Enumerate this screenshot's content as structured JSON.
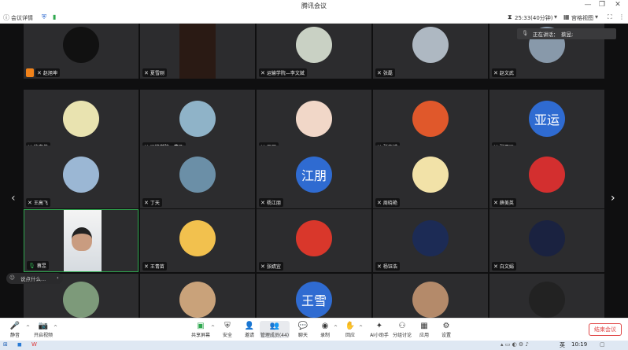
{
  "app": {
    "title": "腾讯会议"
  },
  "infobar": {
    "meeting_details": "会议详情",
    "timer": "25:33(40分钟)",
    "view_label": "宫格视图",
    "speaking_prefix": "正在讲话：",
    "speaking_name": "蔡昱;"
  },
  "participants": [
    {
      "name": "赵旭坤",
      "avatar_text": "",
      "avatar_color": "#111111",
      "host": true
    },
    {
      "name": "夏雪刚",
      "avatar_text": "",
      "avatar_color": "#2a1a14",
      "video": true
    },
    {
      "name": "运输学院—李文斌",
      "avatar_text": "",
      "avatar_color": "#c9d1c4"
    },
    {
      "name": "张磊",
      "avatar_text": "",
      "avatar_color": "#aeb8c2"
    },
    {
      "name": "赵文武",
      "avatar_text": "",
      "avatar_color": "#8899aa"
    },
    {
      "name": "徐志伟",
      "avatar_text": "",
      "avatar_color": "#e9e3b0"
    },
    {
      "name": "运输学院—曹飞",
      "avatar_text": "",
      "avatar_color": "#8fb3c8"
    },
    {
      "name": "马丽",
      "avatar_text": "",
      "avatar_color": "#f1d7c8"
    },
    {
      "name": "张克诚",
      "avatar_text": "",
      "avatar_color": "#e0582b"
    },
    {
      "name": "张亚运",
      "avatar_text": "亚运",
      "avatar_color": "#2f6bd1"
    },
    {
      "name": "王高飞",
      "avatar_text": "",
      "avatar_color": "#9bb7d4"
    },
    {
      "name": "丁天",
      "avatar_text": "",
      "avatar_color": "#6b8fa7"
    },
    {
      "name": "杨江朋",
      "avatar_text": "江朋",
      "avatar_color": "#2f6bd1"
    },
    {
      "name": "周晓艳",
      "avatar_text": "",
      "avatar_color": "#f2e2a8"
    },
    {
      "name": "薛美英",
      "avatar_text": "",
      "avatar_color": "#d32f2f"
    },
    {
      "name": "蔡昱",
      "avatar_text": "",
      "avatar_color": "#e8e8e8",
      "video": true,
      "active": true
    },
    {
      "name": "王青苗",
      "avatar_text": "",
      "avatar_color": "#f2c14e"
    },
    {
      "name": "张婧宜",
      "avatar_text": "",
      "avatar_color": "#d9372b"
    },
    {
      "name": "杨钰浩",
      "avatar_text": "",
      "avatar_color": "#1c2b55"
    },
    {
      "name": "白文娟",
      "avatar_text": "",
      "avatar_color": "#1a2240"
    },
    {
      "name": "",
      "avatar_text": "",
      "avatar_color": "#7d9a7a"
    },
    {
      "name": "",
      "avatar_text": "",
      "avatar_color": "#c9a27a"
    },
    {
      "name": "",
      "avatar_text": "王雪",
      "avatar_color": "#2f6bd1"
    },
    {
      "name": "",
      "avatar_text": "",
      "avatar_color": "#b48a6a"
    },
    {
      "name": "",
      "avatar_text": "",
      "avatar_color": "#222222"
    }
  ],
  "chat": {
    "placeholder": "说点什么..."
  },
  "toolbar": {
    "mute": "静音",
    "video": "开启视频",
    "share": "共享屏幕",
    "security": "安全",
    "invite": "邀请",
    "members": "管理成员(44)",
    "chat": "聊天",
    "record": "录制",
    "replay": "回应",
    "ai": "AI小助手",
    "breakout": "分组讨论",
    "apps": "应用",
    "settings": "设置",
    "end": "结束会议"
  },
  "taskbar": {
    "ime": "英",
    "time": "10:19"
  },
  "colors": {
    "active_border": "#2fa84f",
    "end_button": "#e04545",
    "text_avatar": "#2f6bd1"
  }
}
